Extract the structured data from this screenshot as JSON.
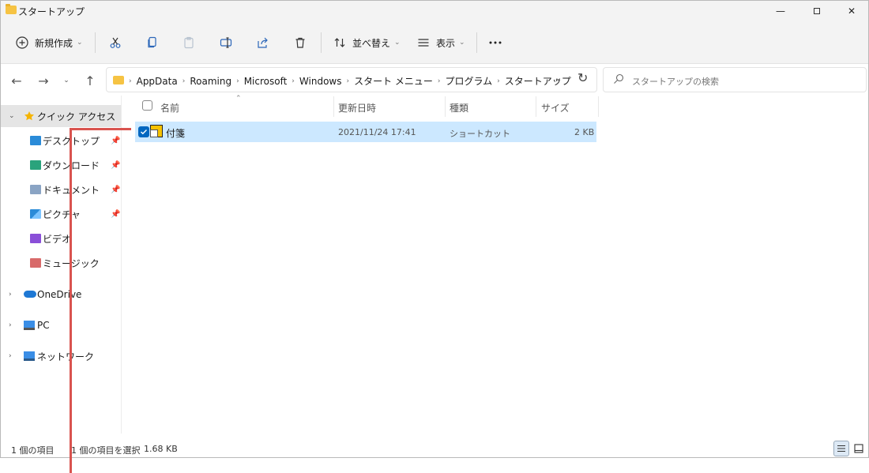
{
  "window": {
    "title": "スタートアップ"
  },
  "toolbar": {
    "new_label": "新規作成",
    "sort_label": "並べ替え",
    "view_label": "表示"
  },
  "breadcrumb": [
    "AppData",
    "Roaming",
    "Microsoft",
    "Windows",
    "スタート メニュー",
    "プログラム",
    "スタートアップ"
  ],
  "search": {
    "placeholder": "スタートアップの検索"
  },
  "nav": {
    "quick_access": "クイック アクセス",
    "desktop": "デスクトップ",
    "downloads": "ダウンロード",
    "documents": "ドキュメント",
    "pictures": "ピクチャ",
    "videos": "ビデオ",
    "music": "ミュージック",
    "onedrive": "OneDrive",
    "pc": "PC",
    "network": "ネットワーク"
  },
  "columns": {
    "name": "名前",
    "date": "更新日時",
    "type": "種類",
    "size": "サイズ"
  },
  "files": [
    {
      "name": "付箋",
      "date": "2021/11/24 17:41",
      "type": "ショートカット",
      "size": "2 KB"
    }
  ],
  "status": {
    "count": "1 個の項目",
    "selected": "1 個の項目を選択",
    "selected_size": "1.68 KB"
  },
  "colors": {
    "accent": "#0067c0",
    "selection": "#cce8ff",
    "annotation": "#d9534f",
    "folder": "#f6c343"
  }
}
